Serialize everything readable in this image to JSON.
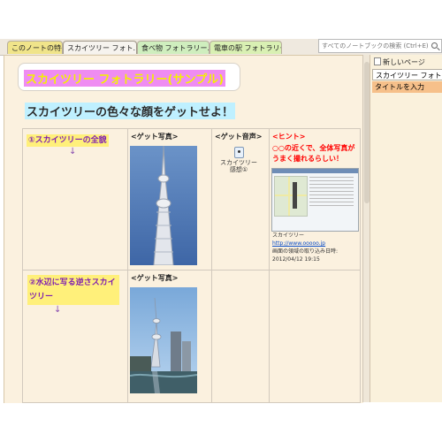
{
  "tabs": [
    {
      "label": "このノートの特長"
    },
    {
      "label": "スカイツリー フォト..."
    },
    {
      "label": "食べ物 フォトラリー..."
    },
    {
      "label": "電車の駅 フォトラリー"
    }
  ],
  "search": {
    "placeholder": "すべてのノートブックの検索 (Ctrl+E)"
  },
  "page": {
    "title": "スカイツリー フォトラリー(サンプル)",
    "subtitle": "スカイツリーの色々な顔をゲットせよ！"
  },
  "table": {
    "row1": {
      "hint": "①スカイツリーの全貌",
      "arrow": "↓",
      "photo_label": "<ゲット写真>",
      "audio_label": "<ゲット音声>",
      "audio_file": "スカイツリー感想①",
      "hint_title": "<ヒント>",
      "hint_body": "○○の近くで、全体写真がうまく撮れるらしい！",
      "clip_caption": "スカイツリー",
      "clip_url": "http://www.ooooo.jp",
      "clip_meta": "画面の領域の取り込み日時:",
      "clip_datetime": "2012/04/12 19:15"
    },
    "row2": {
      "hint": "②水辺に写る逆さスカイツリー",
      "arrow": "↓",
      "photo_label": "<ゲット写真>"
    }
  },
  "sidebar": {
    "new_page": "新しいページ",
    "pages": [
      {
        "label": "スカイツリー フォトラ"
      },
      {
        "label": "タイトルを入力"
      }
    ]
  },
  "icons": {
    "search": "search-icon",
    "audio": "audio-file-icon"
  },
  "colors": {
    "title_bg": "#ef8cf2",
    "title_fg": "#f2f200",
    "subtitle_bg": "#bff0ff",
    "hint_red": "#ff0000"
  }
}
